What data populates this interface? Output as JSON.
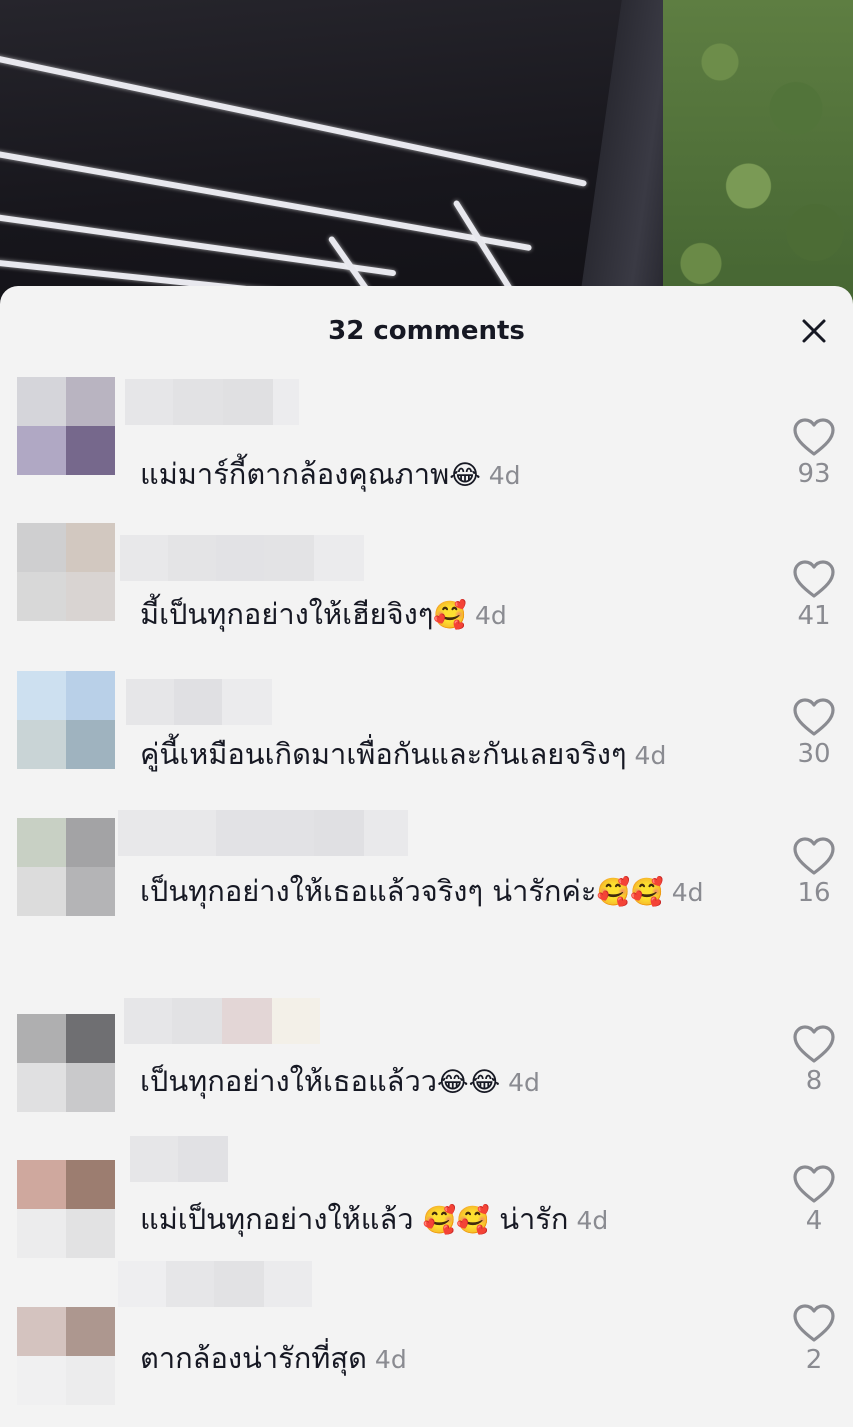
{
  "sheet": {
    "title": "32 comments",
    "close_icon": "close-icon"
  },
  "comments": [
    {
      "text": "แม่มาร์กี้ตากล้องคุณภาพ",
      "emoji": "😂",
      "time": "4d",
      "likes": "93"
    },
    {
      "text": "มี้เป็นทุกอย่างให้เฮียจิงๆ",
      "emoji": "🥰",
      "time": "4d",
      "likes": "41"
    },
    {
      "text": "คู่นี้เหมือนเกิดมาเพื่อกันและกันเลยจริงๆ",
      "emoji": "",
      "time": "4d",
      "likes": "30"
    },
    {
      "text": "เป็นทุกอย่างให้เธอแล้วจริงๆ น่ารักค่ะ",
      "emoji": "🥰🥰",
      "time": "4d",
      "likes": "16"
    },
    {
      "text": "เป็นทุกอย่างให้เธอแล้วว",
      "emoji": "😂😂",
      "time": "4d",
      "likes": "8"
    },
    {
      "text": "แม่เป็นทุกอย่างให้แล้ว ",
      "emoji": "🥰🥰",
      "text_after": " น่ารัก",
      "time": "4d",
      "likes": "4"
    },
    {
      "text": "ตากล้องน่ารักที่สุด",
      "emoji": "",
      "time": "4d",
      "likes": "2"
    }
  ],
  "colors": {
    "sheet_bg": "#f3f3f3",
    "text": "#161823",
    "muted": "#8a8b91"
  },
  "icons": {
    "like": "heart-outline-icon",
    "close": "close-icon"
  }
}
